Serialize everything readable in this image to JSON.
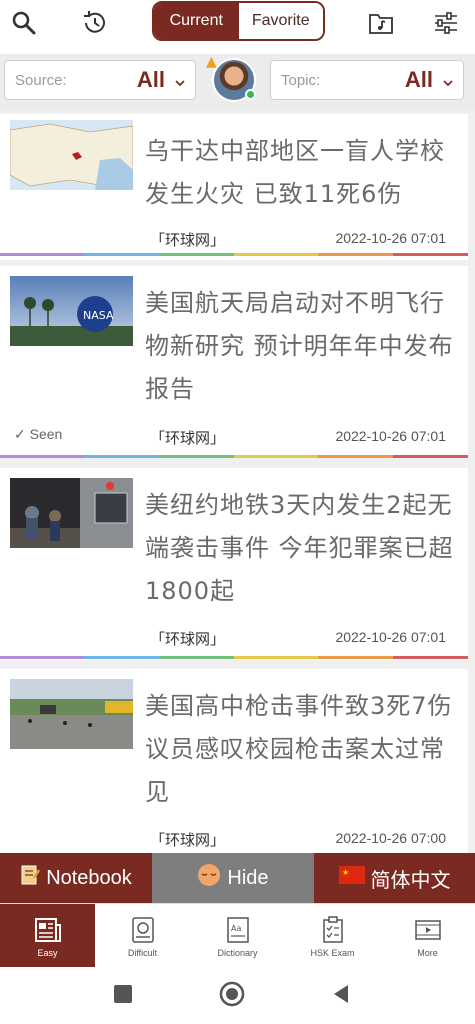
{
  "topbar": {
    "left_icons": [
      "search-icon",
      "history-clock-icon"
    ],
    "segment": {
      "current": "Current",
      "favorite": "Favorite",
      "selected": "Current"
    },
    "right_icons": [
      "music-folder-icon",
      "sliders-icon"
    ]
  },
  "filters": {
    "source": {
      "label": "Source:",
      "value": "All"
    },
    "topic": {
      "label": "Topic:",
      "value": "All"
    }
  },
  "articles": [
    {
      "title": "乌干达中部地区一盲人学校发生火灾 已致11死6伤",
      "source": "「环球网」",
      "date": "2022-10-26 07:01",
      "seen": ""
    },
    {
      "title": "美国航天局启动对不明飞行物新研究 预计明年年中发布报告",
      "source": "「环球网」",
      "date": "2022-10-26 07:01",
      "seen": "✓ Seen"
    },
    {
      "title": "美纽约地铁3天内发生2起无端袭击事件 今年犯罪案已超1800起",
      "source": "「环球网」",
      "date": "2022-10-26 07:01",
      "seen": ""
    },
    {
      "title": "美国高中枪击事件致3死7伤 议员感叹校园枪击案太过常见",
      "source": "「环球网」",
      "date": "2022-10-26 07:00",
      "seen": ""
    }
  ],
  "actions": {
    "notebook": "Notebook",
    "hide": "Hide",
    "language": "简体中文"
  },
  "tabs": [
    {
      "label": "Easy",
      "icon": "newspaper-icon"
    },
    {
      "label": "Difficult",
      "icon": "reading-book-icon"
    },
    {
      "label": "Dictionary",
      "icon": "dictionary-icon"
    },
    {
      "label": "HSK Exam",
      "icon": "clipboard-icon"
    },
    {
      "label": "More",
      "icon": "video-icon"
    }
  ],
  "colors": {
    "brand": "#7b2a22",
    "hide_bar": "#7e7e7e",
    "online": "#2fbf4a"
  }
}
